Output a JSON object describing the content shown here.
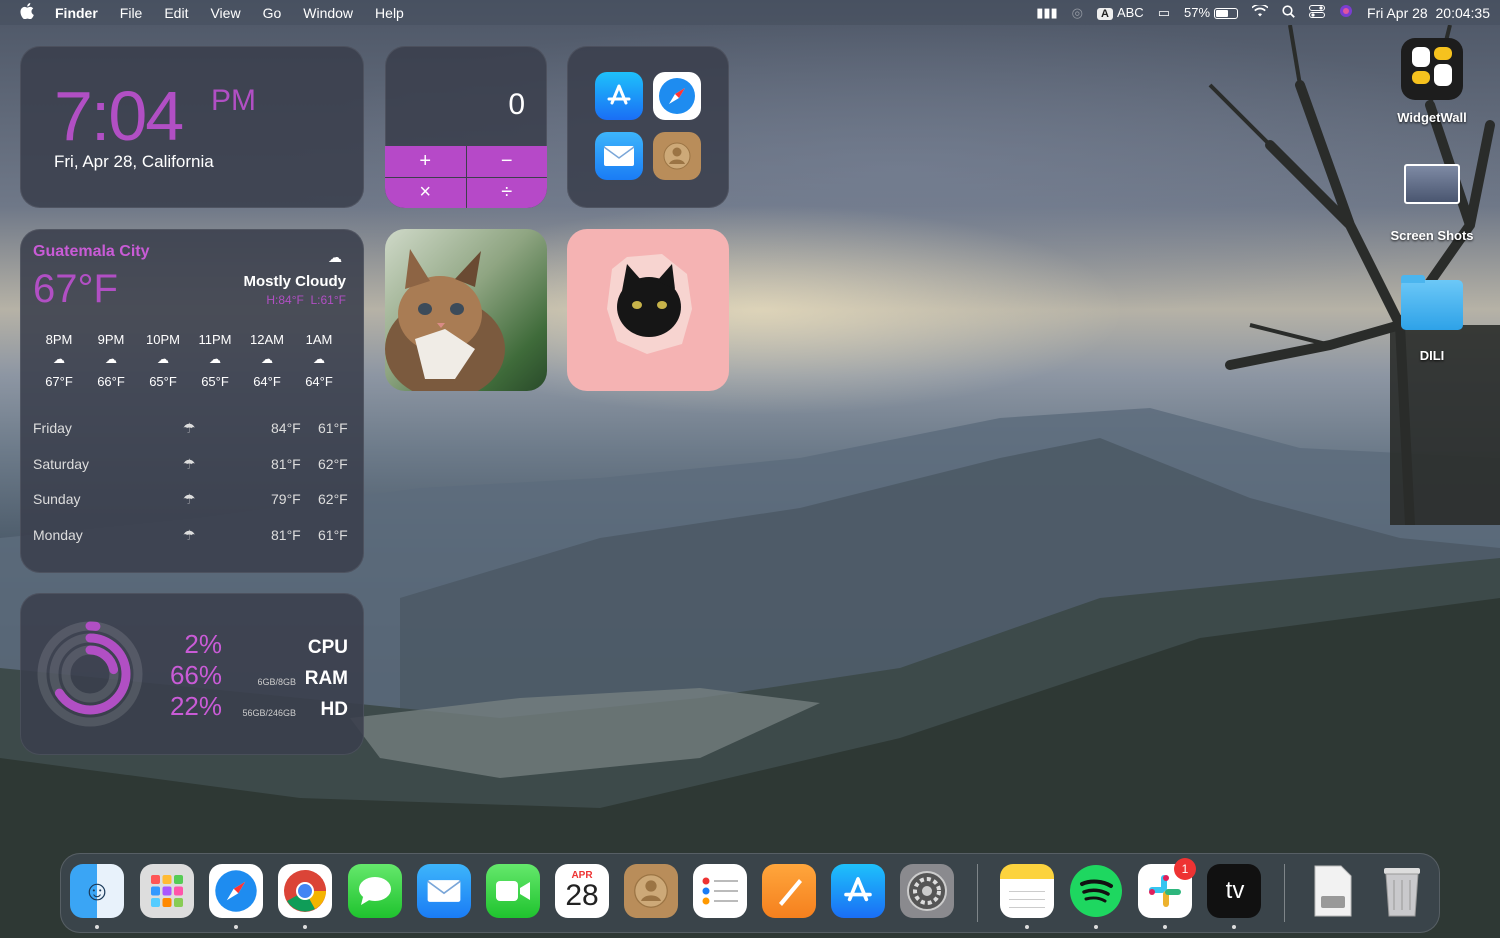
{
  "menubar": {
    "apple": "",
    "items": [
      "Finder",
      "File",
      "Edit",
      "View",
      "Go",
      "Window",
      "Help"
    ],
    "input_source": "ABC",
    "input_badge": "A",
    "battery": "57%",
    "datetime": "Fri Apr 28  20:04:35"
  },
  "clock": {
    "time": "7:04",
    "ampm": "PM",
    "date": "Fri, Apr 28,  California"
  },
  "calculator": {
    "display": "0",
    "keys": [
      "+",
      "−",
      "×",
      "÷"
    ]
  },
  "weather": {
    "city": "Guatemala City",
    "temp": "67°F",
    "condition": "Mostly Cloudy",
    "hilo": "H:84°F  L:61°F",
    "hourly": [
      {
        "time": "8PM",
        "temp": "67°F"
      },
      {
        "time": "9PM",
        "temp": "66°F"
      },
      {
        "time": "10PM",
        "temp": "65°F"
      },
      {
        "time": "11PM",
        "temp": "65°F"
      },
      {
        "time": "12AM",
        "temp": "64°F"
      },
      {
        "time": "1AM",
        "temp": "64°F"
      }
    ],
    "daily": [
      {
        "day": "Friday",
        "high": "84°F",
        "low": "61°F"
      },
      {
        "day": "Saturday",
        "high": "81°F",
        "low": "62°F"
      },
      {
        "day": "Sunday",
        "high": "79°F",
        "low": "62°F"
      },
      {
        "day": "Monday",
        "high": "81°F",
        "low": "61°F"
      }
    ]
  },
  "stats": {
    "cpu": {
      "pct": "2%",
      "label": "CPU",
      "value": 0.02
    },
    "ram": {
      "pct": "66%",
      "label": "RAM",
      "sub": "6GB/8GB",
      "value": 0.66
    },
    "hd": {
      "pct": "22%",
      "label": "HD",
      "sub": "56GB/246GB",
      "value": 0.22
    }
  },
  "desktop": {
    "icons": [
      "WidgetWall",
      "Screen Shots",
      "DILI"
    ]
  },
  "dock": {
    "calendar_month": "APR",
    "calendar_day": "28",
    "tv_label": "tv",
    "slack_badge": "1",
    "apps": [
      "finder",
      "launchpad",
      "safari",
      "chrome",
      "messages",
      "mail",
      "facetime",
      "calendar",
      "contacts",
      "reminders",
      "pages",
      "app-store",
      "system-settings",
      "notes",
      "spotify",
      "slack",
      "apple-tv",
      "preview-disk",
      "trash"
    ]
  },
  "colors": {
    "accent": "#b14fc4"
  }
}
